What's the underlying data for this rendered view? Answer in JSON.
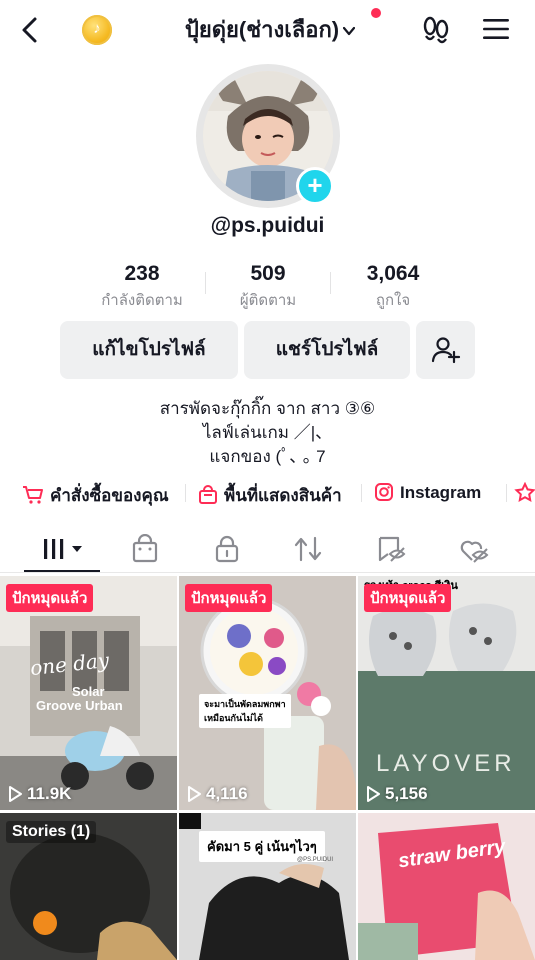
{
  "header": {
    "title": "ปุ้ยดุ่ย(ช่างเลือก)",
    "coin_glyph": "♪",
    "accent": "#fe2c55"
  },
  "profile": {
    "handle": "@ps.puidui",
    "add_glyph": "+"
  },
  "stats": [
    {
      "value": "238",
      "label": "กำลังติดตาม"
    },
    {
      "value": "509",
      "label": "ผู้ติดตาม"
    },
    {
      "value": "3,064",
      "label": "ถูกใจ"
    }
  ],
  "actions": {
    "edit_profile": "แก้ไขโปรไฟล์",
    "share_profile": "แชร์โปรไฟล์"
  },
  "bio": {
    "line1": "สารพัดจะกุ๊กกิ๊ก จาก สาว ③⑥",
    "line2": "ไลฟ์เล่นเกม  ／|、",
    "line3": "แจกของ    (ﾟ､ ｡ 7"
  },
  "links": [
    {
      "label": "คำสั่งซื้อของคุณ",
      "icon": "cart-icon"
    },
    {
      "label": "พื้นที่แสดงสินค้า",
      "icon": "shop-bag-icon"
    },
    {
      "label": "Instagram",
      "icon": "instagram-icon"
    }
  ],
  "tabs": [
    {
      "name": "videos",
      "icon": "grid-bars-icon"
    },
    {
      "name": "shop",
      "icon": "shopping-bag-icon"
    },
    {
      "name": "private",
      "icon": "lock-icon"
    },
    {
      "name": "reposts",
      "icon": "repost-icon"
    },
    {
      "name": "favorites",
      "icon": "bookmark-hidden-icon"
    },
    {
      "name": "liked",
      "icon": "heart-hidden-icon"
    }
  ],
  "videos": [
    {
      "pinned": "ปักหมุดแล้ว",
      "views": "11.9K",
      "overlay1": "one day",
      "overlay2": "Solar",
      "overlay3": "Groove Urban"
    },
    {
      "pinned": "ปักหมุดแล้ว",
      "views": "4,116",
      "overlay1": "จะมาเป็นพัดลมพกพา",
      "overlay2": "เหมือนกันไม่ได้"
    },
    {
      "pinned": "ปักหมุดแล้ว",
      "views": "5,156",
      "overlay1": "LAYOVER",
      "overlay2": "รองเท้า crocs สีเงิน"
    },
    {
      "stories": "Stories (1)"
    },
    {
      "caption": "คัดมา 5 คู่ เน้นๆไวๆ",
      "watermark": "@PS.PUIDUI"
    },
    {
      "overlay1": "straw berry"
    }
  ]
}
